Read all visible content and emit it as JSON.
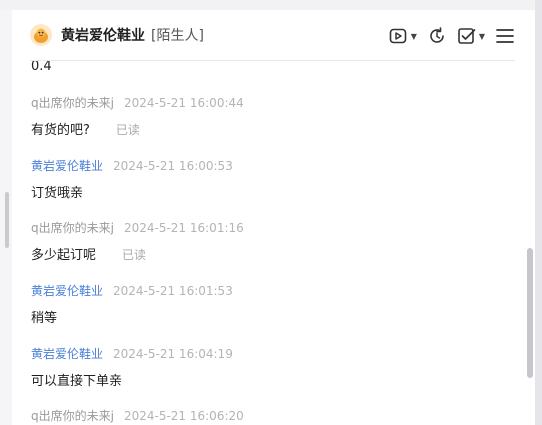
{
  "header": {
    "shop_name": "黄岩爱伦鞋业",
    "tag": "[陌生人]",
    "icons": [
      "video-icon",
      "refresh-icon",
      "check-square-icon",
      "menu-icon"
    ]
  },
  "messages": [
    {
      "kind": "cutoff",
      "text": "0.4"
    },
    {
      "sender": "q出席你的未来j",
      "time": "2024-5-21 16:00:44",
      "text": "有货的吧?",
      "status": "已读",
      "self": false
    },
    {
      "sender": "黄岩爱伦鞋业",
      "time": "2024-5-21 16:00:53",
      "text": "订货哦亲",
      "status": "",
      "self": true
    },
    {
      "sender": "q出席你的未来j",
      "time": "2024-5-21 16:01:16",
      "text": "多少起订呢",
      "status": "已读",
      "self": false
    },
    {
      "sender": "黄岩爱伦鞋业",
      "time": "2024-5-21 16:01:53",
      "text": "稍等",
      "status": "",
      "self": true
    },
    {
      "sender": "黄岩爱伦鞋业",
      "time": "2024-5-21 16:04:19",
      "text": "可以直接下单亲",
      "status": "",
      "self": true
    },
    {
      "sender": "q出席你的未来j",
      "time": "2024-5-21 16:06:20",
      "text": "",
      "status": "",
      "self": false
    }
  ]
}
